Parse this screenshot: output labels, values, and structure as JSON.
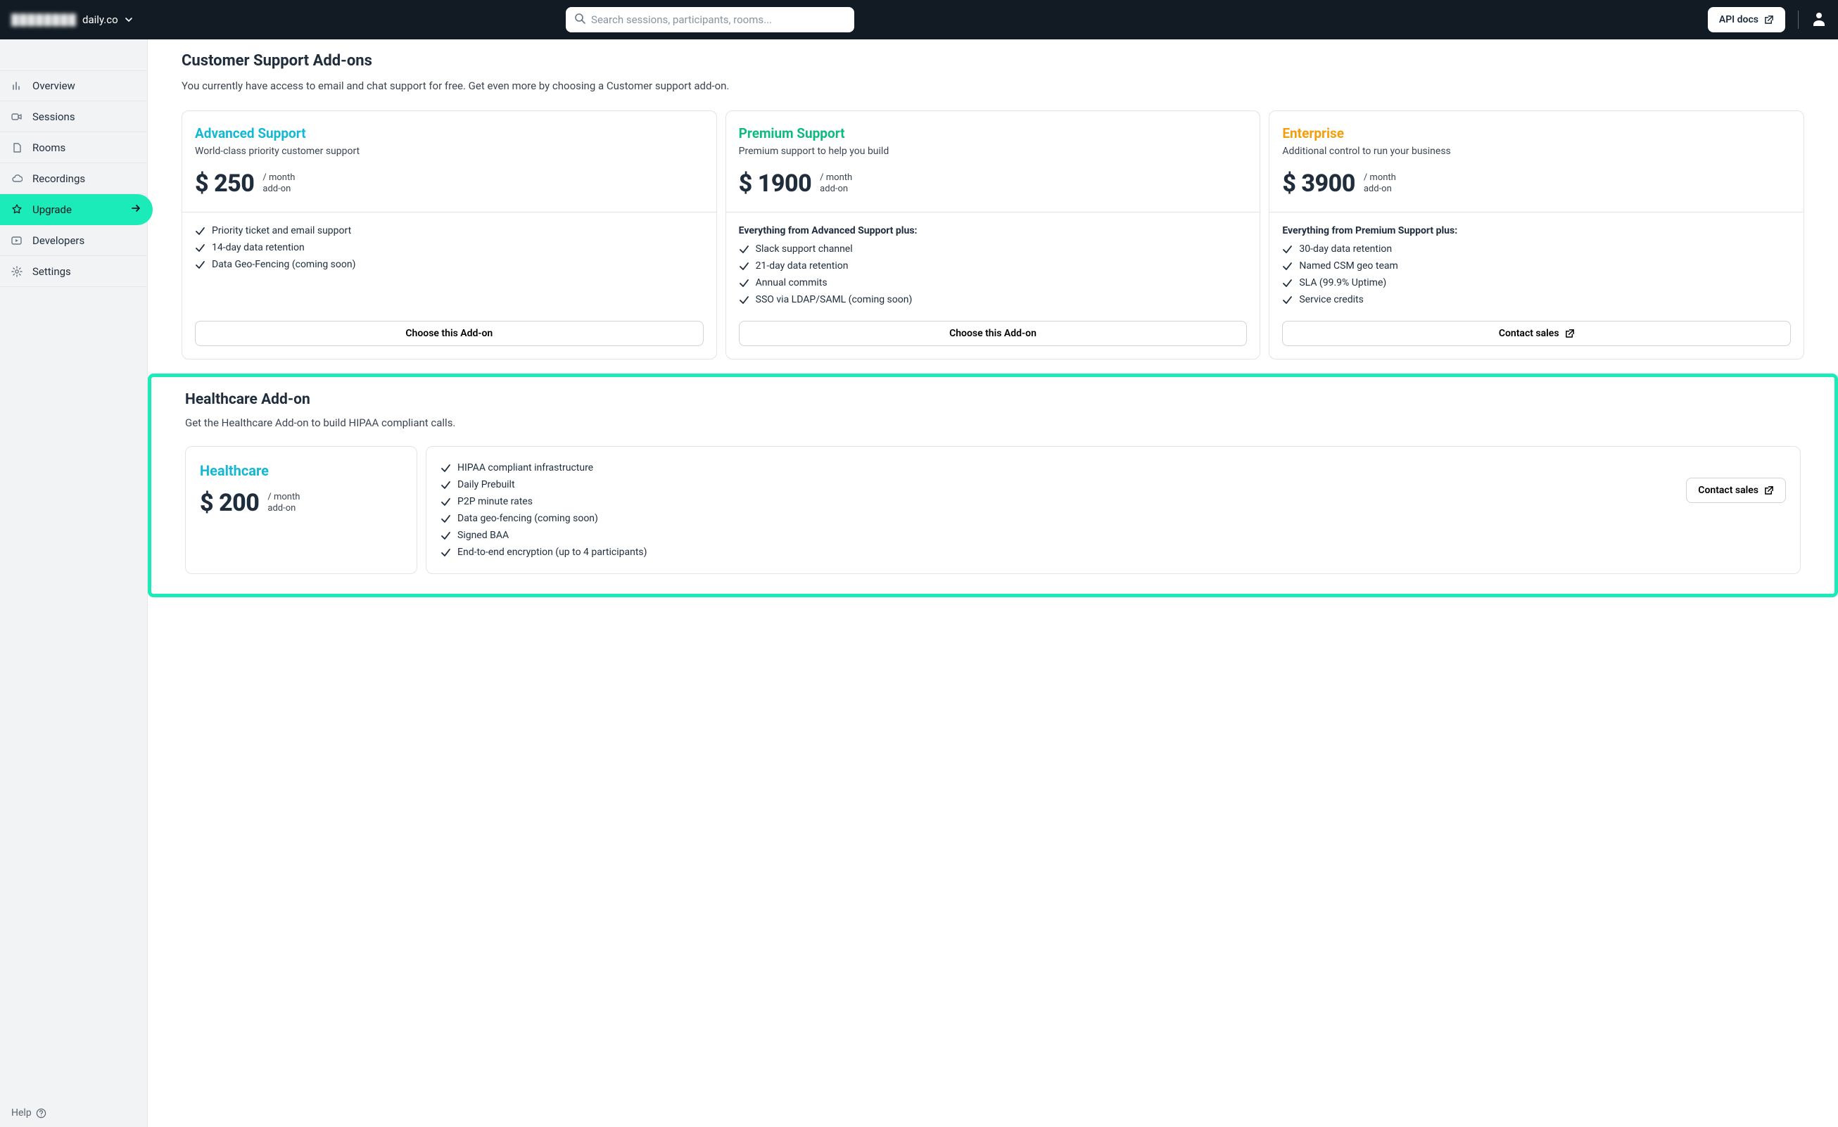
{
  "header": {
    "domain_blur": "████████",
    "domain_suffix": "daily.co",
    "search_placeholder": "Search sessions, participants, rooms...",
    "api_docs_label": "API docs"
  },
  "sidebar": {
    "items": [
      {
        "label": "Overview"
      },
      {
        "label": "Sessions"
      },
      {
        "label": "Rooms"
      },
      {
        "label": "Recordings"
      },
      {
        "label": "Upgrade"
      },
      {
        "label": "Developers"
      },
      {
        "label": "Settings"
      }
    ],
    "help_label": "Help"
  },
  "support_section": {
    "title": "Customer Support Add-ons",
    "description": "You currently have access to email and chat support for free. Get even more by choosing a Customer support add-on.",
    "per_label_1": "/ month",
    "per_label_2": "add-on",
    "plans": [
      {
        "name": "Advanced Support",
        "sub": "World-class priority customer support",
        "price": "$ 250",
        "features": [
          "Priority ticket and email support",
          "14-day data retention",
          "Data Geo-Fencing (coming soon)"
        ],
        "cta": "Choose this Add-on",
        "includes_prefix": ""
      },
      {
        "name": "Premium Support",
        "sub": "Premium support to help you build",
        "price": "$ 1900",
        "includes_prefix": "Everything from Advanced Support plus:",
        "features": [
          "Slack support channel",
          "21-day data retention",
          "Annual commits",
          "SSO via LDAP/SAML (coming soon)"
        ],
        "cta": "Choose this Add-on"
      },
      {
        "name": "Enterprise",
        "sub": "Additional control to run your business",
        "price": "$ 3900",
        "includes_prefix": "Everything from Premium Support plus:",
        "features": [
          "30-day data retention",
          "Named CSM geo team",
          "SLA (99.9% Uptime)",
          "Service credits"
        ],
        "cta": "Contact sales"
      }
    ]
  },
  "healthcare_section": {
    "title": "Healthcare Add-on",
    "description": "Get the Healthcare Add-on to build HIPAA compliant calls.",
    "plan_name": "Healthcare",
    "price": "$ 200",
    "features": [
      "HIPAA compliant infrastructure",
      "Daily Prebuilt",
      "P2P minute rates",
      "Data geo-fencing (coming soon)",
      "Signed BAA",
      "End-to-end encryption (up to 4 participants)"
    ],
    "cta": "Contact sales"
  }
}
